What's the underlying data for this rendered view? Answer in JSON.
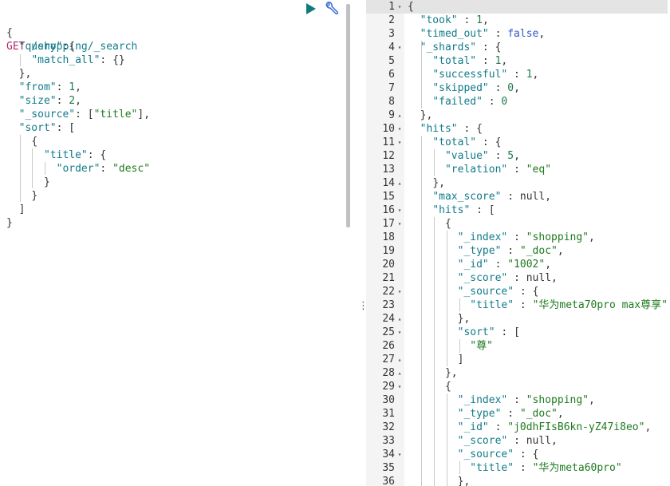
{
  "colors": {
    "key": "#117b8a",
    "string": "#1f7a1f",
    "method": "#b1266b",
    "play": "#117b7b",
    "wrench": "#3b6bd6",
    "gutter_bg": "#f4f4f4",
    "active_line_bg": "#e4e4e4"
  },
  "toolbar": {
    "run_icon": "play-icon",
    "settings_icon": "wrench-icon"
  },
  "request": {
    "method": "GET",
    "url": " /shopping/_search",
    "body_lines": [
      "{",
      "  \"query\":{",
      "    \"match_all\": {}",
      "  },",
      "  \"from\": 1,",
      "  \"size\": 2,",
      "  \"_source\": [\"title\"],",
      "  \"sort\": [",
      "    {",
      "      \"title\": {",
      "        \"order\": \"desc\"",
      "      }",
      "    }",
      "  ]",
      "}"
    ]
  },
  "response": {
    "line_numbers": [
      "1",
      "2",
      "3",
      "4",
      "5",
      "6",
      "7",
      "8",
      "9",
      "10",
      "11",
      "12",
      "13",
      "14",
      "15",
      "16",
      "17",
      "18",
      "19",
      "20",
      "21",
      "22",
      "23",
      "24",
      "25",
      "26",
      "27",
      "28",
      "29",
      "30",
      "31",
      "32",
      "33",
      "34",
      "35",
      "36"
    ],
    "lines": [
      "{",
      "  \"took\" : 1,",
      "  \"timed_out\" : false,",
      "  \"_shards\" : {",
      "    \"total\" : 1,",
      "    \"successful\" : 1,",
      "    \"skipped\" : 0,",
      "    \"failed\" : 0",
      "  },",
      "  \"hits\" : {",
      "    \"total\" : {",
      "      \"value\" : 5,",
      "      \"relation\" : \"eq\"",
      "    },",
      "    \"max_score\" : null,",
      "    \"hits\" : [",
      "      {",
      "        \"_index\" : \"shopping\",",
      "        \"_type\" : \"_doc\",",
      "        \"_id\" : \"1002\",",
      "        \"_score\" : null,",
      "        \"_source\" : {",
      "          \"title\" : \"华为meta70pro max尊享\"",
      "        },",
      "        \"sort\" : [",
      "          \"尊\"",
      "        ]",
      "      },",
      "      {",
      "        \"_index\" : \"shopping\",",
      "        \"_type\" : \"_doc\",",
      "        \"_id\" : \"j0dhFIsB6kn-yZ47i8eo\",",
      "        \"_score\" : null,",
      "        \"_source\" : {",
      "          \"title\" : \"华为meta60pro\"",
      "        },"
    ],
    "fold_open": [
      "1",
      "4",
      "10",
      "11",
      "16",
      "17",
      "22",
      "25",
      "29",
      "34"
    ],
    "fold_close": [
      "9",
      "14",
      "24",
      "27",
      "28"
    ]
  }
}
